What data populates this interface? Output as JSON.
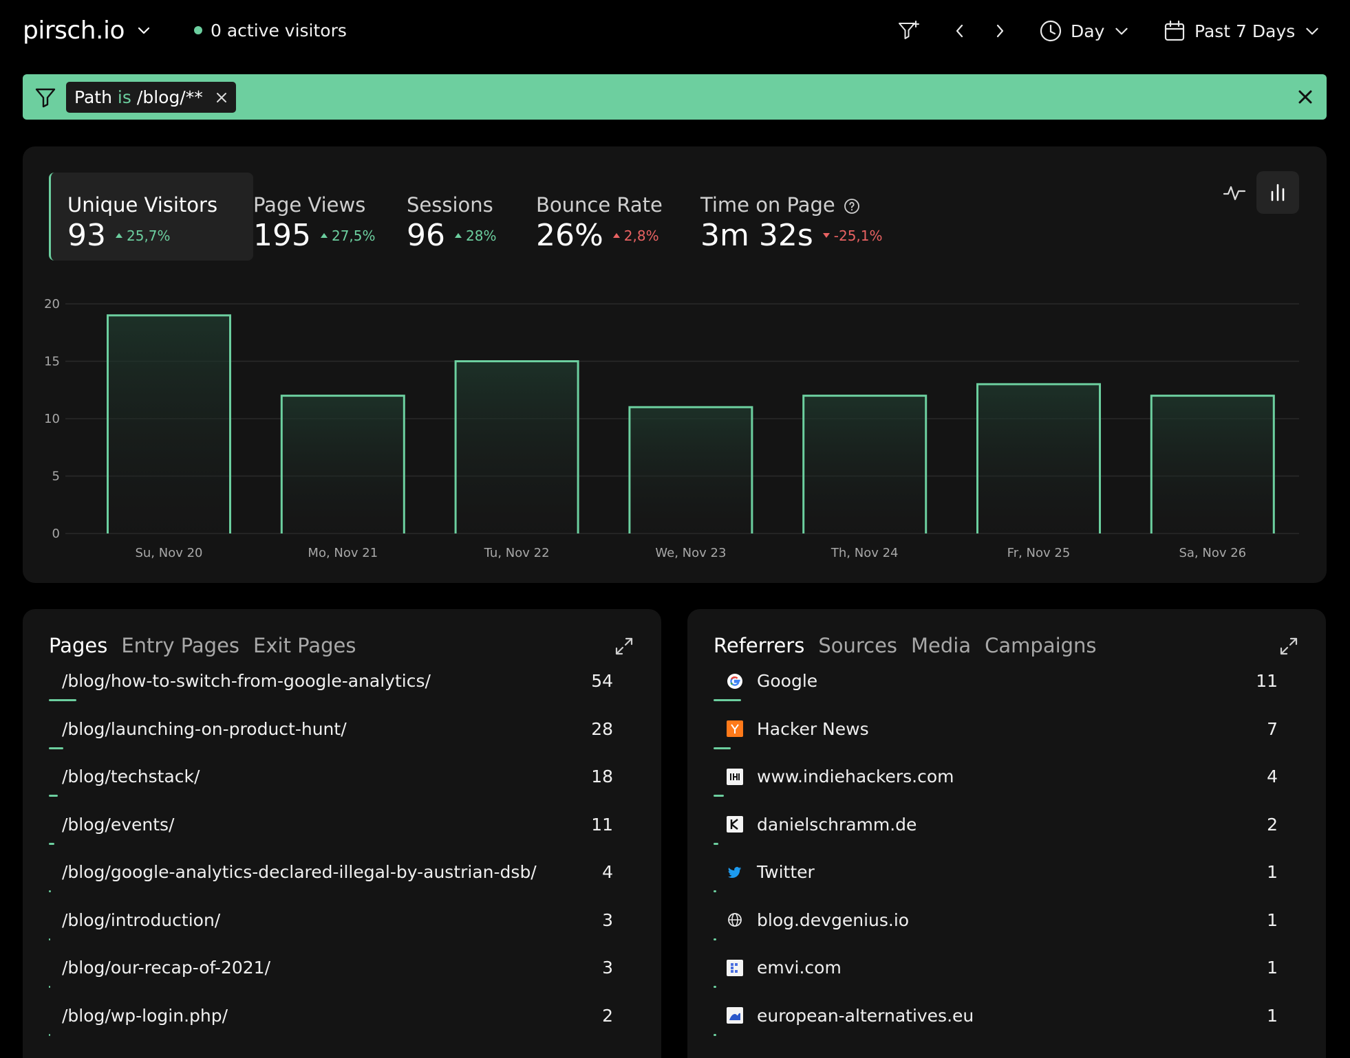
{
  "header": {
    "site": "pirsch.io",
    "active_visitors": "0 active visitors",
    "period_unit": "Day",
    "date_range": "Past 7 Days"
  },
  "filter": {
    "field": "Path",
    "operator": "is",
    "value": "/blog/**"
  },
  "metrics": [
    {
      "label": "Unique Visitors",
      "value": "93",
      "delta": "25,7%",
      "trend": "up"
    },
    {
      "label": "Page Views",
      "value": "195",
      "delta": "27,5%",
      "trend": "up"
    },
    {
      "label": "Sessions",
      "value": "96",
      "delta": "28%",
      "trend": "up"
    },
    {
      "label": "Bounce Rate",
      "value": "26%",
      "delta": "2,8%",
      "trend": "up_bad"
    },
    {
      "label": "Time on Page",
      "value": "3m 32s",
      "delta": "-25,1%",
      "trend": "down_bad"
    }
  ],
  "colors": {
    "accent": "#6ccf9f",
    "negative": "#e96262",
    "panel": "#141414",
    "background": "#000000"
  },
  "chart_data": {
    "type": "bar",
    "categories": [
      "Su, Nov 20",
      "Mo, Nov 21",
      "Tu, Nov 22",
      "We, Nov 23",
      "Th, Nov 24",
      "Fr, Nov 25",
      "Sa, Nov 26"
    ],
    "values": [
      19,
      12,
      15,
      11,
      12,
      13,
      12
    ],
    "ylim": [
      0,
      20
    ],
    "yticks": [
      "0",
      "5",
      "10",
      "15",
      "20"
    ],
    "grid": true
  },
  "pages_panel": {
    "tabs": [
      "Pages",
      "Entry Pages",
      "Exit Pages"
    ],
    "rows": [
      {
        "label": "/blog/how-to-switch-from-google-analytics/",
        "value": "54"
      },
      {
        "label": "/blog/launching-on-product-hunt/",
        "value": "28"
      },
      {
        "label": "/blog/techstack/",
        "value": "18"
      },
      {
        "label": "/blog/events/",
        "value": "11"
      },
      {
        "label": "/blog/google-analytics-declared-illegal-by-austrian-dsb/",
        "value": "4"
      },
      {
        "label": "/blog/introduction/",
        "value": "3"
      },
      {
        "label": "/blog/our-recap-of-2021/",
        "value": "3"
      },
      {
        "label": "/blog/wp-login.php/",
        "value": "2"
      }
    ]
  },
  "referrers_panel": {
    "tabs": [
      "Referrers",
      "Sources",
      "Media",
      "Campaigns"
    ],
    "rows": [
      {
        "label": "Google",
        "value": "11",
        "icon": "google-icon"
      },
      {
        "label": "Hacker News",
        "value": "7",
        "icon": "hacker-news-icon"
      },
      {
        "label": "www.indiehackers.com",
        "value": "4",
        "icon": "indiehackers-icon"
      },
      {
        "label": "danielschramm.de",
        "value": "2",
        "icon": "danielschramm-icon"
      },
      {
        "label": "Twitter",
        "value": "1",
        "icon": "twitter-icon"
      },
      {
        "label": "blog.devgenius.io",
        "value": "1",
        "icon": "globe-icon"
      },
      {
        "label": "emvi.com",
        "value": "1",
        "icon": "emvi-icon"
      },
      {
        "label": "european-alternatives.eu",
        "value": "1",
        "icon": "european-alternatives-icon"
      }
    ]
  }
}
